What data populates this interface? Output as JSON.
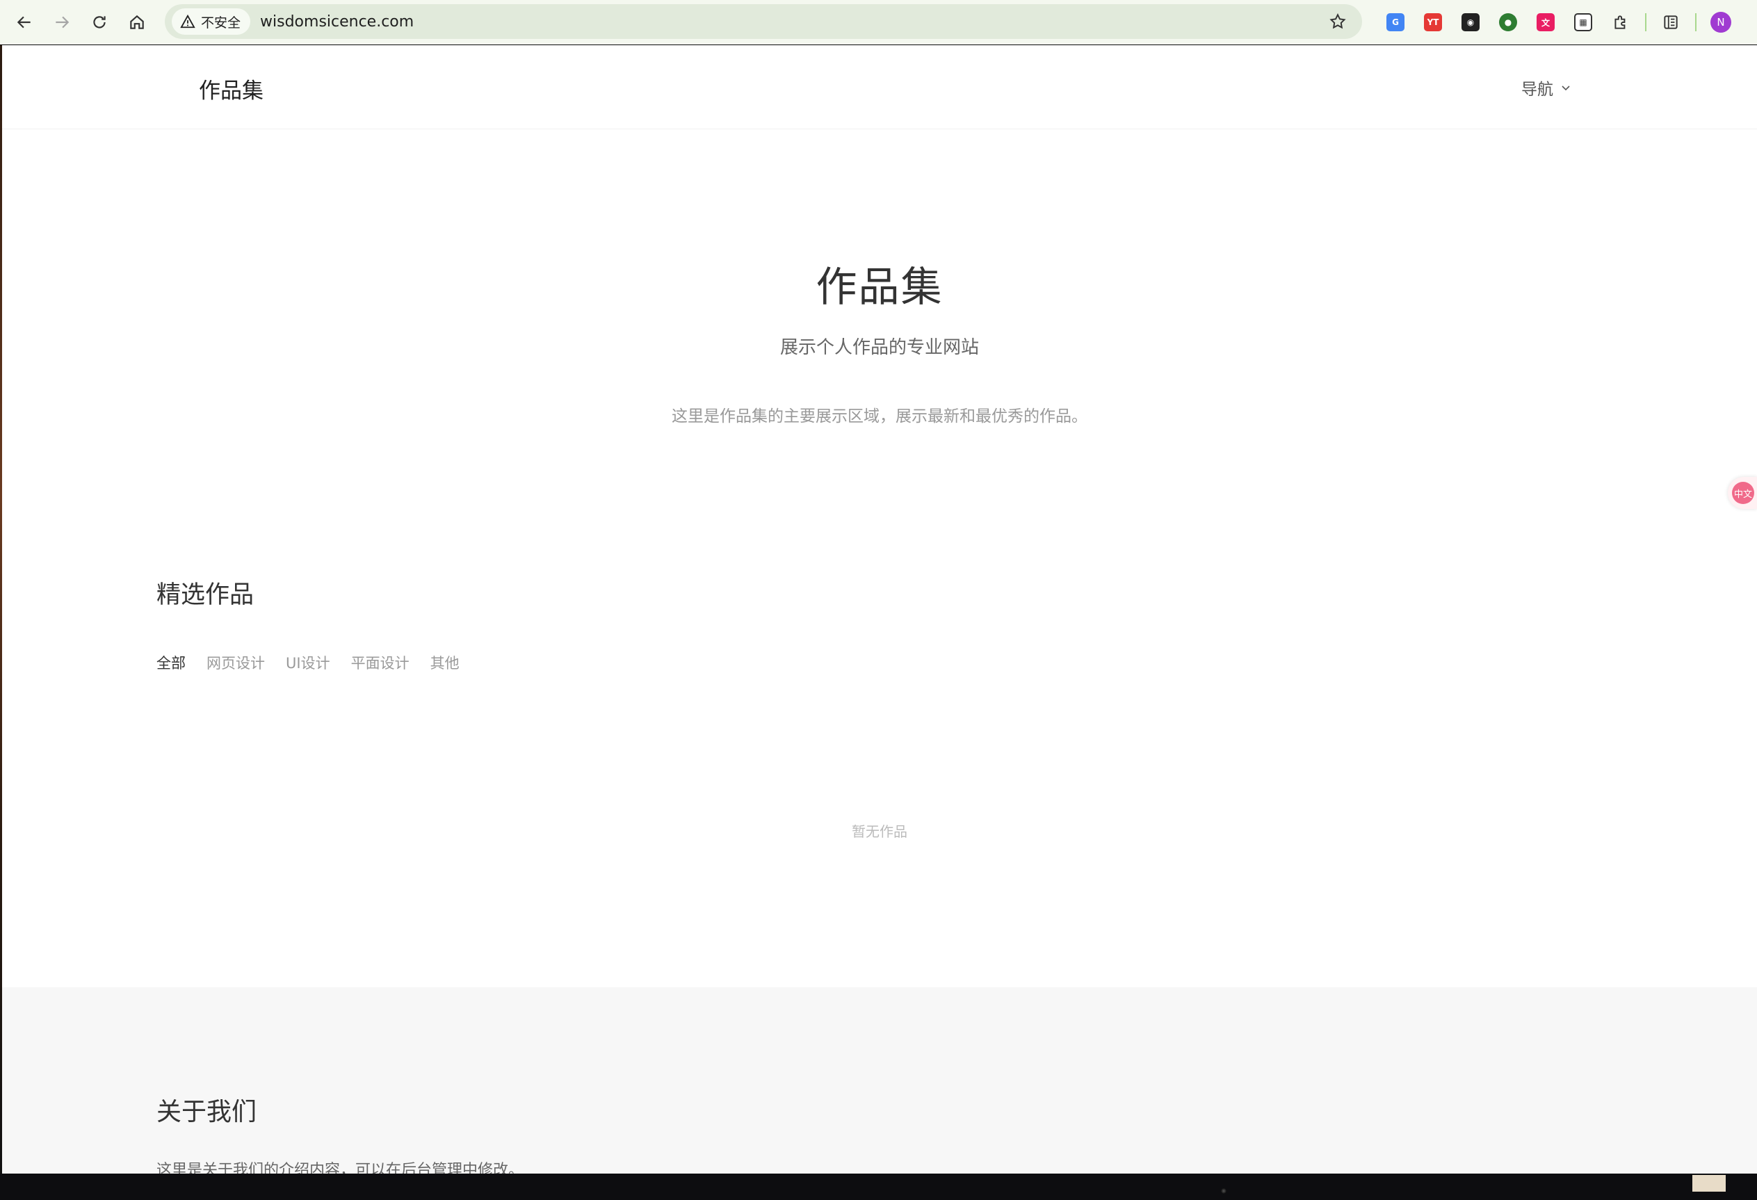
{
  "browser": {
    "security_label": "不安全",
    "url": "wisdomsicence.com",
    "icons": {
      "back": "arrow-left-icon",
      "forward": "arrow-right-icon",
      "reload": "reload-icon",
      "home": "home-icon",
      "warning": "warning-icon",
      "bookmark": "star-icon"
    },
    "extensions": [
      {
        "name": "google-translate-extension",
        "glyph": "G",
        "color": "#4285f4"
      },
      {
        "name": "youtube-extension",
        "glyph": "YT",
        "color": "#e53935"
      },
      {
        "name": "glasses-extension",
        "glyph": "◉",
        "color": "#222222"
      },
      {
        "name": "globe-extension",
        "glyph": "●",
        "color": "#2e7d32"
      },
      {
        "name": "translate-pink-extension",
        "glyph": "文",
        "color": "#e91e63"
      },
      {
        "name": "qr-code-extension",
        "glyph": "▦",
        "color": "#555555"
      }
    ],
    "profile_initial": "N"
  },
  "site": {
    "logo": "作品集",
    "nav_label": "导航"
  },
  "hero": {
    "title": "作品集",
    "subtitle": "展示个人作品的专业网站",
    "description": "这里是作品集的主要展示区域，展示最新和最优秀的作品。"
  },
  "works": {
    "title": "精选作品",
    "filters": [
      "全部",
      "网页设计",
      "UI设计",
      "平面设计",
      "其他"
    ],
    "active_filter": "全部",
    "empty_text": "暂无作品"
  },
  "about": {
    "title": "关于我们",
    "text": "这里是关于我们的介绍内容，可以在后台管理中修改。"
  },
  "translate_widget": "中文"
}
